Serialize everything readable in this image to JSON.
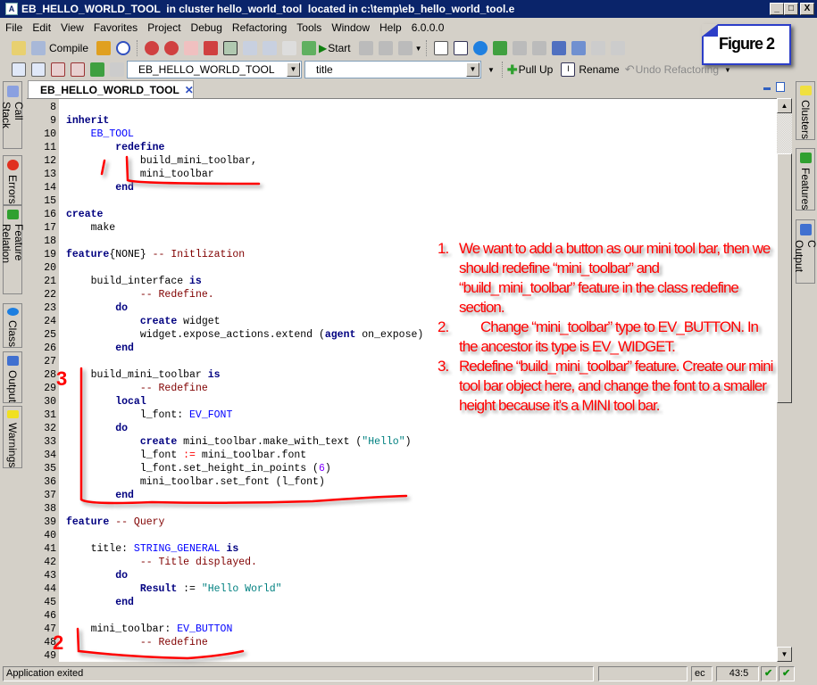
{
  "window": {
    "title": "EB_HELLO_WORLD_TOOL  in cluster hello_world_tool  located in c:\\temp\\eb_hello_world_tool.e",
    "minimize": "_",
    "maximize": "□",
    "close": "X"
  },
  "menu": [
    "File",
    "Edit",
    "View",
    "Favorites",
    "Project",
    "Debug",
    "Refactoring",
    "Tools",
    "Window",
    "Help",
    "6.0.0.0"
  ],
  "toolbar1": {
    "compile": "Compile",
    "start": "Start"
  },
  "toolbar2": {
    "class_combo": "EB_HELLO_WORLD_TOOL",
    "feature_combo": "title",
    "pull_up": "Pull Up",
    "rename": "Rename",
    "undo_refactoring": "Undo Refactoring"
  },
  "editor_tab": {
    "label": "EB_HELLO_WORLD_TOOL"
  },
  "left_dock": [
    "Call Stack",
    "Errors",
    "Feature Relation",
    "Class",
    "Output",
    "Warnings"
  ],
  "right_dock": [
    "Clusters",
    "Features",
    "C Output"
  ],
  "code": {
    "first_line": 8,
    "lines": [
      [],
      [
        [
          "kw",
          "inherit"
        ]
      ],
      [
        [
          "",
          "    "
        ],
        [
          "ty",
          "EB_TOOL"
        ]
      ],
      [
        [
          "",
          "        "
        ],
        [
          "kw",
          "redefine"
        ]
      ],
      [
        [
          "",
          "            build_mini_toolbar,"
        ]
      ],
      [
        [
          "",
          "            mini_toolbar"
        ]
      ],
      [
        [
          "",
          "        "
        ],
        [
          "kw",
          "end"
        ]
      ],
      [],
      [
        [
          "kw",
          "create"
        ]
      ],
      [
        [
          "",
          "    make"
        ]
      ],
      [],
      [
        [
          "kw",
          "feature"
        ],
        [
          "",
          "{NONE} "
        ],
        [
          "cm",
          "-- Initlization"
        ]
      ],
      [],
      [
        [
          "",
          "    build_interface "
        ],
        [
          "kw",
          "is"
        ]
      ],
      [
        [
          "",
          "            "
        ],
        [
          "cm",
          "-- Redefine."
        ]
      ],
      [
        [
          "",
          "        "
        ],
        [
          "kw",
          "do"
        ]
      ],
      [
        [
          "",
          "            "
        ],
        [
          "kw",
          "create"
        ],
        [
          "",
          " widget"
        ]
      ],
      [
        [
          "",
          "            widget.expose_actions.extend ("
        ],
        [
          "kw",
          "agent"
        ],
        [
          "",
          " on_expose)"
        ]
      ],
      [
        [
          "",
          "        "
        ],
        [
          "kw",
          "end"
        ]
      ],
      [],
      [
        [
          "",
          "    build_mini_toolbar "
        ],
        [
          "kw",
          "is"
        ]
      ],
      [
        [
          "",
          "            "
        ],
        [
          "cm",
          "-- Redefine"
        ]
      ],
      [
        [
          "",
          "        "
        ],
        [
          "kw",
          "local"
        ]
      ],
      [
        [
          "",
          "            l_font: "
        ],
        [
          "ty",
          "EV_FONT"
        ]
      ],
      [
        [
          "",
          "        "
        ],
        [
          "kw",
          "do"
        ]
      ],
      [
        [
          "",
          "            "
        ],
        [
          "kw",
          "create"
        ],
        [
          "",
          " mini_toolbar.make_with_text ("
        ],
        [
          "st",
          "\"Hello\""
        ],
        [
          "",
          ")"
        ]
      ],
      [
        [
          "",
          "            l_font "
        ],
        [
          "op",
          ":="
        ],
        [
          "",
          " mini_toolbar.font"
        ]
      ],
      [
        [
          "",
          "            l_font.set_height_in_points ("
        ],
        [
          "nu",
          "6"
        ],
        [
          "",
          ")"
        ]
      ],
      [
        [
          "",
          "            mini_toolbar.set_font (l_font)"
        ]
      ],
      [
        [
          "",
          "        "
        ],
        [
          "kw",
          "end"
        ]
      ],
      [],
      [
        [
          "kw",
          "feature"
        ],
        [
          "",
          " "
        ],
        [
          "cm",
          "-- Query"
        ]
      ],
      [],
      [
        [
          "",
          "    title: "
        ],
        [
          "ty",
          "STRING_GENERAL"
        ],
        [
          "",
          " "
        ],
        [
          "kw",
          "is"
        ]
      ],
      [
        [
          "",
          "            "
        ],
        [
          "cm",
          "-- Title displayed."
        ]
      ],
      [
        [
          "",
          "        "
        ],
        [
          "kw",
          "do"
        ]
      ],
      [
        [
          "",
          "            "
        ],
        [
          "kw",
          "Result"
        ],
        [
          "",
          " := "
        ],
        [
          "st",
          "\"Hello World\""
        ]
      ],
      [
        [
          "",
          "        "
        ],
        [
          "kw",
          "end"
        ]
      ],
      [],
      [
        [
          "",
          "    mini_toolbar: "
        ],
        [
          "ty",
          "EV_BUTTON"
        ]
      ],
      [
        [
          "",
          "            "
        ],
        [
          "cm",
          "-- Redefine"
        ]
      ],
      []
    ]
  },
  "annotations": {
    "figure_label": "Figure 2",
    "markers": [
      "3",
      "2"
    ],
    "notes": [
      {
        "num": "1.",
        "text": "We want to add a button as our mini tool bar, then we should redefine “mini_toolbar” and “build_mini_toolbar” feature in the class redefine section."
      },
      {
        "num": "2.",
        "text": "Change “mini_toolbar” type to EV_BUTTON. In the ancestor its type is EV_WIDGET."
      },
      {
        "num": "3.",
        "text": "Redefine “build_mini_toolbar” feature. Create our mini tool bar object here, and change the font to a smaller height because it’s a MINI tool bar."
      }
    ]
  },
  "status": {
    "message": "Application exited",
    "mode": "ec",
    "position": "43:5"
  }
}
